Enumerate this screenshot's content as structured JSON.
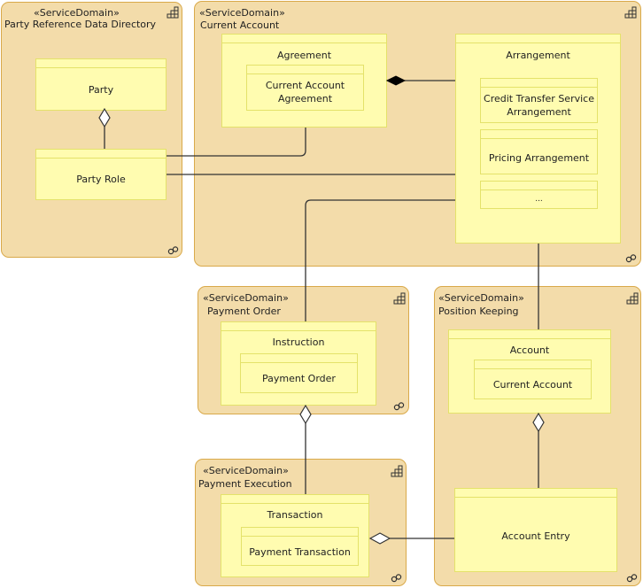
{
  "stereotype": "«ServiceDomain»",
  "domains": {
    "prdd": {
      "name": "Party Reference Data Directory"
    },
    "current_account": {
      "name": "Current Account"
    },
    "payment_order": {
      "name": "Payment Order"
    },
    "position_keeping": {
      "name": "Position Keeping"
    },
    "payment_execution": {
      "name": "Payment Execution"
    }
  },
  "classes": {
    "party": "Party",
    "party_role": "Party Role",
    "agreement": "Agreement",
    "current_account_agreement_l1": "Current Account",
    "current_account_agreement_l2": "Agreement",
    "arrangement": "Arrangement",
    "credit_transfer_l1": "Credit Transfer Service",
    "credit_transfer_l2": "Arrangement",
    "pricing_arrangement": "Pricing Arrangement",
    "ellipsis": "...",
    "instruction": "Instruction",
    "payment_order": "Payment Order",
    "account": "Account",
    "current_account": "Current Account",
    "account_entry": "Account Entry",
    "transaction": "Transaction",
    "payment_transaction": "Payment Transaction"
  },
  "colors": {
    "domain_fill": "#f3dcaa",
    "domain_border": "#d9a94a",
    "class_fill": "#fffcb0",
    "class_border": "#e4e26a",
    "connector": "#333333"
  }
}
